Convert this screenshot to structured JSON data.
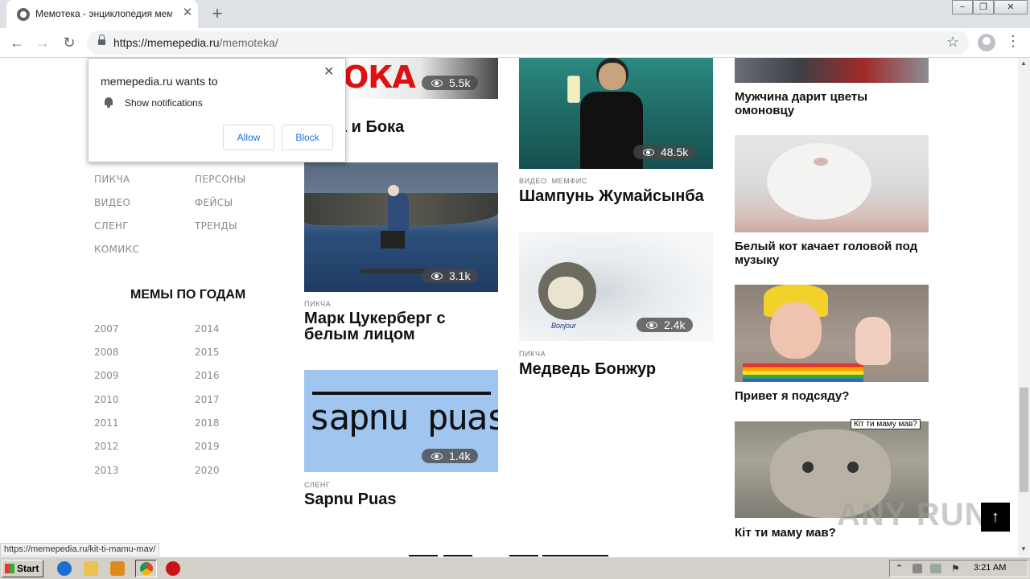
{
  "browser": {
    "tab_title": "Мемотека - энциклопедия мемов",
    "url_host": "https://memepedia.ru",
    "url_path": "/memoteka/",
    "window_buttons": [
      "−",
      "❐",
      "✕"
    ]
  },
  "permission_popup": {
    "title": "memepedia.ru wants to",
    "permission": "Show notifications",
    "allow_label": "Allow",
    "block_label": "Block"
  },
  "sidebar": {
    "categories_left": [
      "ПИКЧА",
      "ВИДЕО",
      "СЛЕНГ",
      "КОМИКС"
    ],
    "categories_right": [
      "ПЕРСОНЫ",
      "ФЕЙСЫ",
      "ТРЕНДЫ"
    ],
    "years_title": "МЕМЫ ПО ГОДАМ",
    "years_left": [
      "2007",
      "2008",
      "2009",
      "2010",
      "2011",
      "2012",
      "2013"
    ],
    "years_right": [
      "2014",
      "2015",
      "2016",
      "2017",
      "2018",
      "2019",
      "2020"
    ]
  },
  "cards": {
    "boka": {
      "views": "5.5k",
      "title": "а и Бока",
      "image_text": "ОКА"
    },
    "zuckerberg": {
      "views": "3.1k",
      "tag": "ПИКЧА",
      "title_line1": "Марк Цукерберг с",
      "title_line2": "белым лицом"
    },
    "sapnu": {
      "views": "1.4k",
      "tag": "СЛЕНГ",
      "title": "Sapnu Puas",
      "image_text": "sapnu puas"
    },
    "shampoo": {
      "views": "48.5k",
      "tag1": "ВИДЕО",
      "tag2": "МЕМФИС",
      "title": "Шампунь Жумайсынба"
    },
    "bear": {
      "views": "2.4k",
      "tag": "ПИКЧА",
      "title": "Медведь Бонжур",
      "image_text": "Bonjour"
    },
    "flowers": {
      "title_line1": "Мужчина дарит цветы",
      "title_line2": "омоновцу"
    },
    "cat_nod": {
      "title_line1": "Белый кот качает головой под",
      "title_line2": "музыку"
    },
    "sit_down": {
      "title": "Привет я подсяду?"
    },
    "kit": {
      "title": "Кіт ти маму мав?"
    }
  },
  "tooltip": "Кіт ти маму мав?",
  "watermark": "ANY RUN",
  "status_url": "https://memepedia.ru/kit-ti-mamu-mav/",
  "taskbar": {
    "start_label": "Start",
    "clock": "3:21 AM"
  },
  "colors": {
    "accent_blue": "#1a73e8",
    "sapnu_bg": "#a0c6f0"
  }
}
